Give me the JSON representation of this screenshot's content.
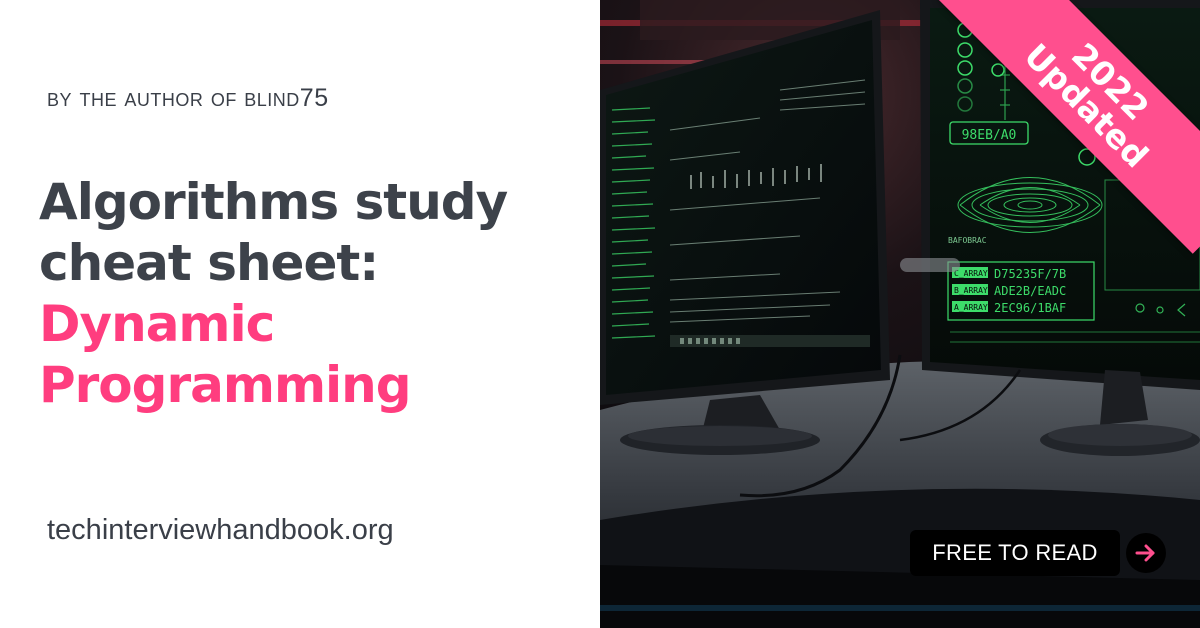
{
  "byline": "By the author of Blind75",
  "title": {
    "line1": "Algorithms study",
    "line2": "cheat sheet:",
    "highlight1": "Dynamic",
    "highlight2": "Programming"
  },
  "site": "techinterviewhandbook.org",
  "ribbon": {
    "year": "2022",
    "label": "Updated"
  },
  "cta": {
    "label": "FREE TO READ",
    "arrow_icon": "arrow-right-icon"
  },
  "screen": {
    "code": "98EB/A0",
    "panel_label": "BAFOBRAC",
    "arrays": [
      {
        "name": "C_ARRAY",
        "value": "D75235F/7B"
      },
      {
        "name": "B_ARRAY",
        "value": "ADE2B/EADC"
      },
      {
        "name": "A_ARRAY",
        "value": "2EC96/1BAF"
      }
    ]
  },
  "colors": {
    "accent": "#ff3d7f",
    "ribbon": "#ff4f8e",
    "text_dark": "#3d424a",
    "terminal_green": "#3ddc6a"
  }
}
